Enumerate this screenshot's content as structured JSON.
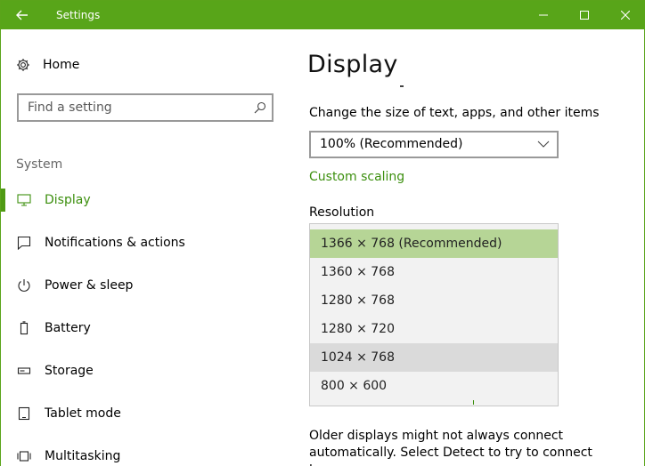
{
  "window": {
    "title": "Settings"
  },
  "sidebar": {
    "home": "Home",
    "search_placeholder": "Find a setting",
    "section": "System",
    "items": [
      {
        "label": "Display",
        "active": true
      },
      {
        "label": "Notifications & actions"
      },
      {
        "label": "Power & sleep"
      },
      {
        "label": "Battery"
      },
      {
        "label": "Storage"
      },
      {
        "label": "Tablet mode"
      },
      {
        "label": "Multitasking"
      }
    ]
  },
  "main": {
    "title": "Display",
    "scale_label": "Change the size of text, apps, and other items",
    "scale_value": "100% (Recommended)",
    "custom_scaling": "Custom scaling",
    "resolution_label": "Resolution",
    "resolution_options": [
      "1366 × 768 (Recommended)",
      "1360 × 768",
      "1280 × 768",
      "1280 × 720",
      "1024 × 768",
      "800 × 600"
    ],
    "older_text": "Older displays might not always connect automatically. Select Detect to try to connect to"
  },
  "colors": {
    "accent": "#58a519",
    "selected": "#b6d596",
    "link": "#3c8f0e"
  }
}
